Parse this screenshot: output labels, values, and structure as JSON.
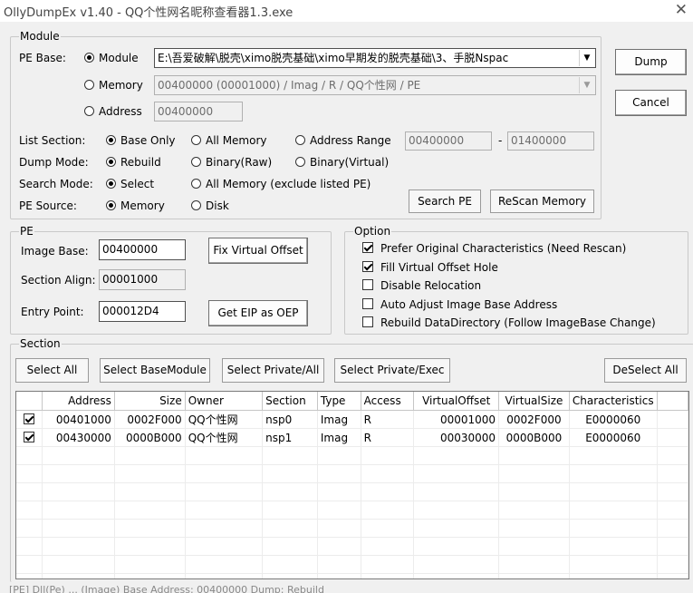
{
  "window": {
    "title": "OllyDumpEx v1.40 - QQ个性网名昵称查看器1.3.exe",
    "close": "✕"
  },
  "module_group": {
    "label": "Module",
    "pe_base_label": "PE Base:",
    "radio_module": "Module",
    "module_path": "E:\\吾爱破解\\脱壳\\ximo脱壳基础\\ximo早期发的脱壳基础\\3、手脱Nspac",
    "radio_memory": "Memory",
    "memory_value": "00400000 (00001000) / Imag / R    / QQ个性网 / PE",
    "radio_address": "Address",
    "address_value": "00400000",
    "list_section_label": "List Section:",
    "opt_base_only": "Base Only",
    "opt_all_memory": "All Memory",
    "opt_address_range": "Address Range",
    "range_from": "00400000",
    "range_sep": "-",
    "range_to": "01400000",
    "dump_mode_label": "Dump Mode:",
    "opt_rebuild": "Rebuild",
    "opt_binary_raw": "Binary(Raw)",
    "opt_binary_virtual": "Binary(Virtual)",
    "search_mode_label": "Search Mode:",
    "opt_select": "Select",
    "opt_all_memory_excl": "All Memory (exclude listed PE)",
    "pe_source_label": "PE Source:",
    "opt_src_memory": "Memory",
    "opt_src_disk": "Disk",
    "search_pe": "Search PE",
    "rescan_memory": "ReScan Memory"
  },
  "buttons": {
    "dump": "Dump",
    "cancel": "Cancel"
  },
  "pe_group": {
    "label": "PE",
    "image_base_label": "Image Base:",
    "image_base": "00400000",
    "section_align_label": "Section Align:",
    "section_align": "00001000",
    "entry_point_label": "Entry Point:",
    "entry_point": "000012D4",
    "fix_virtual_offset": "Fix Virtual Offset",
    "get_eip_as_oep": "Get EIP as OEP"
  },
  "option_group": {
    "label": "Option",
    "items": [
      {
        "label": "Prefer Original Characteristics (Need Rescan)",
        "checked": true
      },
      {
        "label": "Fill Virtual Offset Hole",
        "checked": true
      },
      {
        "label": "Disable Relocation",
        "checked": false
      },
      {
        "label": "Auto Adjust Image Base Address",
        "checked": false
      },
      {
        "label": "Rebuild DataDirectory (Follow ImageBase Change)",
        "checked": false
      }
    ]
  },
  "section_group": {
    "label": "Section",
    "select_all": "Select All",
    "select_base_module": "Select BaseModule",
    "select_private_all": "Select Private/All",
    "select_private_exec": "Select Private/Exec",
    "deselect_all": "DeSelect All",
    "columns": [
      "Address",
      "Size",
      "Owner",
      "Section",
      "Type",
      "Access",
      "VirtualOffset",
      "VirtualSize",
      "Characteristics"
    ],
    "rows": [
      {
        "checked": true,
        "cells": [
          "00401000",
          "0002F000",
          "QQ个性网",
          "nsp0",
          "Imag",
          "R",
          "00001000",
          "0002F000",
          "E0000060"
        ]
      },
      {
        "checked": true,
        "cells": [
          "00430000",
          "0000B000",
          "QQ个性网",
          "nsp1",
          "Imag",
          "R",
          "00030000",
          "0000B000",
          "E0000060"
        ]
      }
    ]
  },
  "status_text": "[PE] Dll(Pe) ... (Image) Base Address: 00400000  Dump: Rebuild"
}
